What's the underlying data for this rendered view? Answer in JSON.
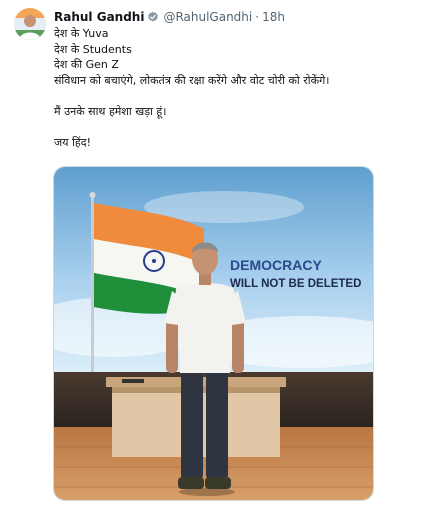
{
  "tweet": {
    "author_name": "Rahul Gandhi",
    "handle": "@RahulGandhi",
    "separator": "·",
    "time": "18h",
    "lines": [
      "देश के Yuva",
      "देश के Students",
      "देश की Gen Z",
      "संविधान को बचाएंगे, लोकतंत्र की रक्षा करेंगे और वोट चोरी को रोकेंगे।",
      "",
      "मैं उनके साथ हमेशा खड़ा हूं।",
      "",
      "जय हिंद!"
    ]
  },
  "media": {
    "banner_line1": "DEMOCRACY",
    "banner_line2": "WILL NOT BE DELETED",
    "colors": {
      "saffron": "#f08a3c",
      "green": "#1f8f3a",
      "chakra": "#2a3a8c",
      "text_dark": "#1d2a4a",
      "sky_top": "#5f9fcf",
      "floor": "#c98a52"
    }
  },
  "icons": {
    "verified": "verified-badge-icon",
    "avatar": "avatar"
  }
}
